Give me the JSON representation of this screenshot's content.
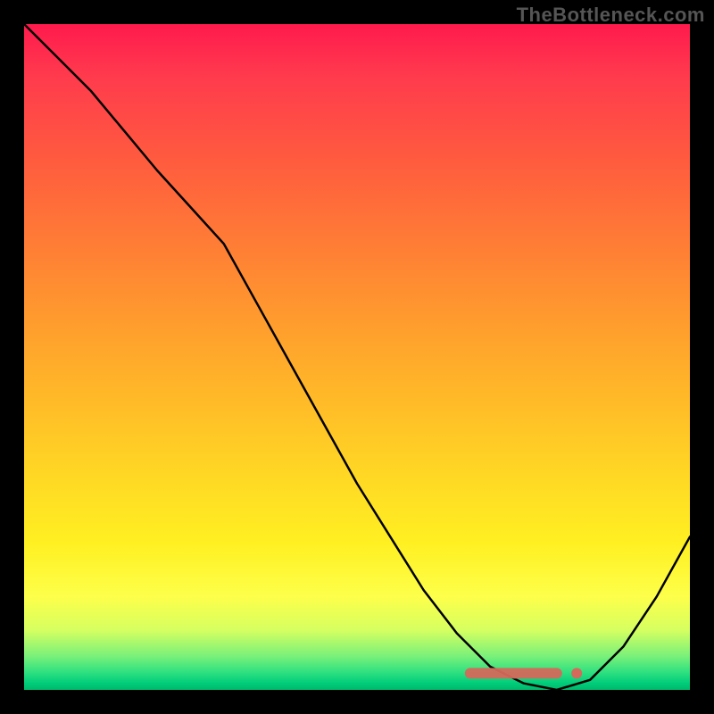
{
  "watermark": "TheBottleneck.com",
  "colors": {
    "background": "#000000",
    "curve": "#000000",
    "optimum": "#d46a5c"
  },
  "chart_data": {
    "type": "line",
    "title": "",
    "xlabel": "",
    "ylabel": "",
    "xlim": [
      0,
      100
    ],
    "ylim": [
      0,
      100
    ],
    "x": [
      0,
      5,
      10,
      15,
      20,
      25,
      30,
      35,
      40,
      45,
      50,
      55,
      60,
      65,
      70,
      75,
      80,
      85,
      90,
      95,
      100
    ],
    "values": [
      100,
      95,
      90,
      84,
      78,
      72.5,
      67,
      58,
      49,
      40,
      31,
      23,
      15,
      8.5,
      3.5,
      1,
      0,
      1.5,
      6.5,
      14,
      23
    ],
    "optimum": {
      "x_start": 67,
      "x_end": 80,
      "dot_x": 83,
      "y": 2.5
    }
  }
}
